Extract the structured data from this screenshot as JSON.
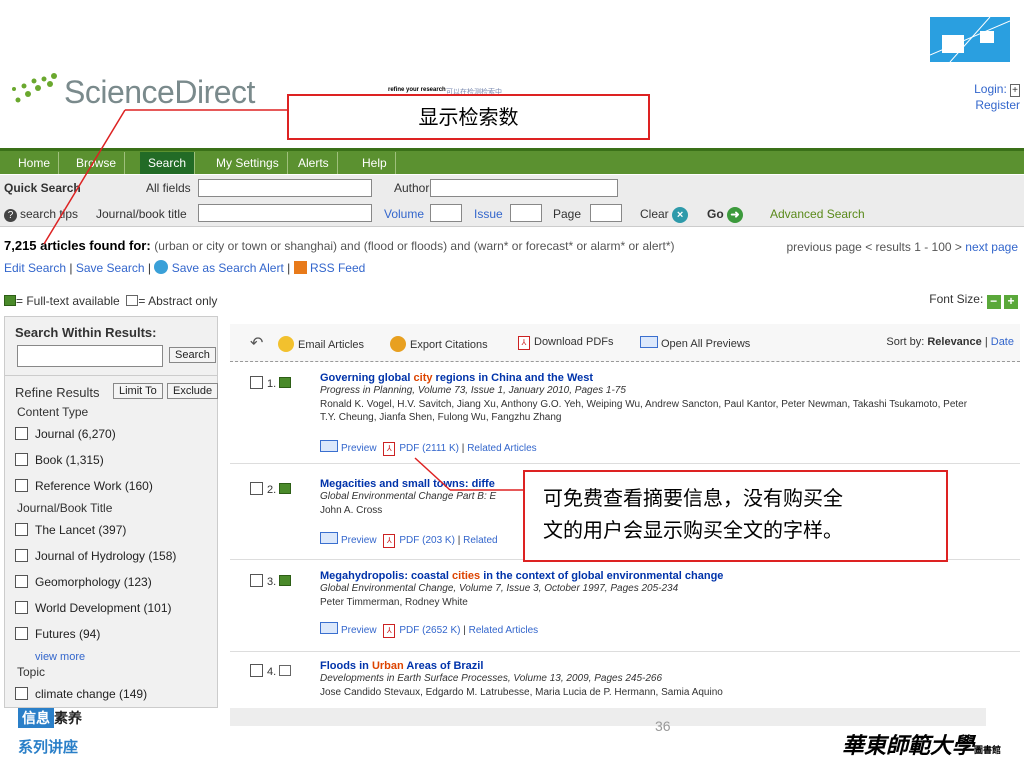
{
  "header": {
    "logo_text": "ScienceDirect",
    "refine_text": "refine your research",
    "refine_sub": "可以在检测检索中",
    "login": "Login:",
    "register": "Register"
  },
  "callout_top": "显示检索数",
  "callout_bottom": {
    "line1": "可免费查看摘要信息，没有购买全",
    "line2": "文的用户会显示购买全文的字样。"
  },
  "nav": [
    "Home",
    "Browse",
    "Search",
    "My Settings",
    "Alerts",
    "Help"
  ],
  "quick_search": {
    "title": "Quick Search",
    "all_fields": "All fields",
    "author": "Author",
    "search_tips": "search tips",
    "journal_title": "Journal/book title",
    "volume": "Volume",
    "issue": "Issue",
    "page": "Page",
    "clear": "Clear",
    "go": "Go",
    "advanced": "Advanced Search"
  },
  "results_summary": {
    "count": "7,215 articles found for:",
    "query": "(urban or city or town or shanghai) and (flood or floods) and (warn* or forecast* or alarm* or alert*)",
    "prev": "previous page",
    "range": "< results 1 - 100 >",
    "next": "next page",
    "edit_search": "Edit Search",
    "save_search": "Save Search",
    "save_alert": "Save as Search Alert",
    "rss": "RSS Feed"
  },
  "legend": {
    "full_text": "= Full-text available",
    "abstract": "= Abstract only",
    "font_size": "Font Size:"
  },
  "sidebar": {
    "search_within": "Search Within Results:",
    "search_btn": "Search",
    "refine": "Refine Results",
    "limit_to": "Limit To",
    "exclude": "Exclude",
    "content_type": "Content Type",
    "content_items": [
      "Journal (6,270)",
      "Book (1,315)",
      "Reference Work (160)"
    ],
    "journal_title": "Journal/Book Title",
    "journal_items": [
      "The Lancet (397)",
      "Journal of Hydrology (158)",
      "Geomorphology (123)",
      "World Development (101)",
      "Futures (94)"
    ],
    "view_more": "view more",
    "topic": "Topic",
    "topic_items": [
      "climate change (149)"
    ]
  },
  "toolbar": {
    "email": "Email Articles",
    "export": "Export Citations",
    "download": "Download PDFs",
    "previews": "Open All Previews",
    "sort_by": "Sort by:",
    "relevance": "Relevance",
    "date": "Date"
  },
  "results": [
    {
      "num": "1.",
      "title_a": "Governing global ",
      "title_hl": "city",
      "title_b": " regions in China and the West",
      "source": "Progress in Planning, Volume 73, Issue 1, January 2010, Pages 1-75",
      "authors": "Ronald K. Vogel, H.V. Savitch, Jiang Xu, Anthony G.O. Yeh, Weiping Wu, Andrew Sancton, Paul Kantor, Peter Newman, Takashi Tsukamoto, Peter T.Y. Cheung, Jianfa Shen, Fulong Wu, Fangzhu Zhang",
      "preview": "Preview",
      "pdf": "PDF (2111 K)",
      "related": "Related Articles"
    },
    {
      "num": "2.",
      "title_a": "Megacities and small towns: diffe",
      "title_hl": "",
      "title_b": "",
      "source": "Global Environmental Change Part B: E",
      "authors": "John A. Cross",
      "preview": "Preview",
      "pdf": "PDF (203 K)",
      "related": "Related"
    },
    {
      "num": "3.",
      "title_a": "Megahydropolis: coastal ",
      "title_hl": "cities",
      "title_b": " in the context of global environmental change",
      "source": "Global Environmental Change, Volume 7, Issue 3, October 1997, Pages 205-234",
      "authors": "Peter Timmerman, Rodney White",
      "preview": "Preview",
      "pdf": "PDF (2652 K)",
      "related": "Related Articles"
    },
    {
      "num": "4.",
      "title_a": "Floods in ",
      "title_hl": "Urban",
      "title_b": " Areas of Brazil",
      "source": "Developments in Earth Surface Processes, Volume 13, 2009, Pages 245-266",
      "authors": "Jose Candido Stevaux, Edgardo M. Latrubesse, Maria Lucia de P. Hermann, Samia Aquino",
      "preview": "",
      "pdf": "",
      "related": ""
    }
  ],
  "footer": {
    "brand_box": "信息",
    "brand_text": "素养",
    "series": "系列讲座",
    "page": "36",
    "university": "華東師範大學",
    "library": "圖書館"
  }
}
